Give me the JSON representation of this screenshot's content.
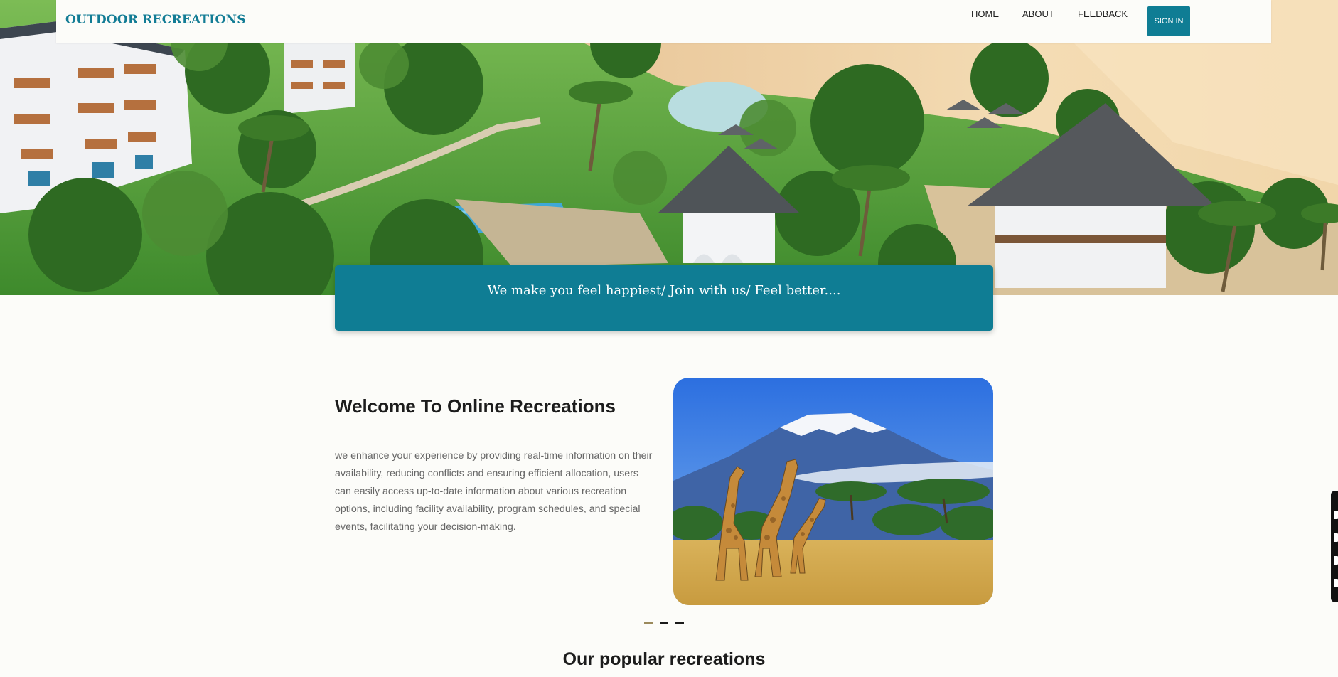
{
  "navbar": {
    "brand": "OUTDOOR RECREATIONS",
    "links": [
      "HOME",
      "ABOUT",
      "FEEDBACK"
    ],
    "signin_label": "SIGN IN",
    "accent_color": "#0f7d94"
  },
  "banner": {
    "text": "We make you feel happiest/ Join with us/ Feel better...."
  },
  "welcome": {
    "title": "Welcome To Online Recreations",
    "body": "we enhance your experience by providing real-time information on their availability, reducing conflicts and ensuring efficient allocation, users can easily access up-to-date information about various recreation options, including facility availability, program schedules, and special events, facilitating your decision-making."
  },
  "carousel": {
    "slide_count": 3,
    "active_index": 0
  },
  "popular": {
    "title": "Our popular recreations"
  },
  "icons": [
    "resort-hero-image",
    "giraffe-safari-image"
  ]
}
